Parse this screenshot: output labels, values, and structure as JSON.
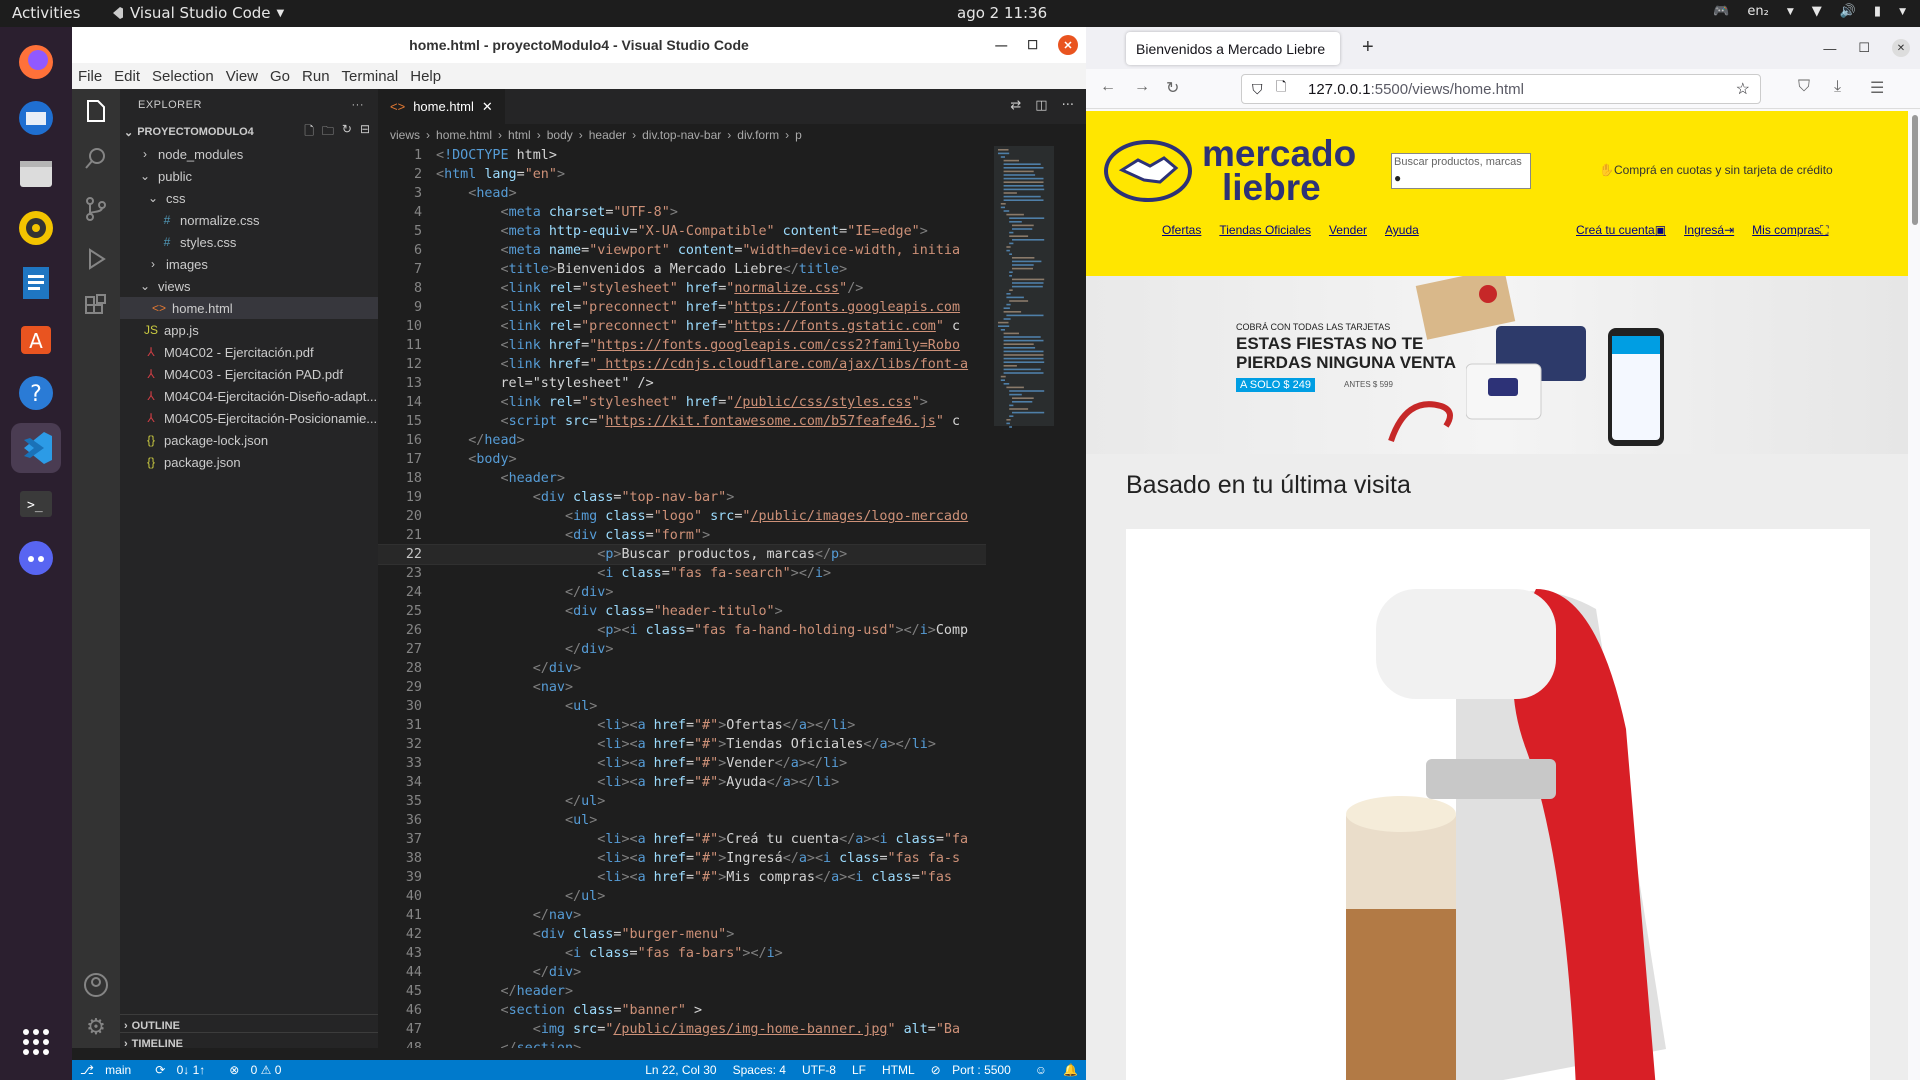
{
  "topbar": {
    "activities": "Activities",
    "app_name": "Visual Studio Code",
    "clock": "ago 2  11:36",
    "lang": "en₂"
  },
  "dock": {
    "items": [
      "firefox-icon",
      "thunderbird-icon",
      "files-icon",
      "rhythmbox-icon",
      "writer-icon",
      "software-icon",
      "help-icon",
      "vscode-icon",
      "terminal-icon",
      "discord-icon",
      "apps-grid-icon"
    ]
  },
  "vscode": {
    "title": "home.html - proyectoModulo4 - Visual Studio Code",
    "menu": [
      "File",
      "Edit",
      "Selection",
      "View",
      "Go",
      "Run",
      "Terminal",
      "Help"
    ],
    "explorer": {
      "header": "EXPLORER",
      "project": "PROYECTOMODULO4",
      "tree": [
        {
          "label": "node_modules",
          "type": "folder",
          "level": 1
        },
        {
          "label": "public",
          "type": "folder-open",
          "level": 1
        },
        {
          "label": "css",
          "type": "folder-open",
          "level": 2
        },
        {
          "label": "normalize.css",
          "type": "css",
          "level": 3
        },
        {
          "label": "styles.css",
          "type": "css",
          "level": 3
        },
        {
          "label": "images",
          "type": "folder",
          "level": 2
        },
        {
          "label": "views",
          "type": "folder-open",
          "level": 1
        },
        {
          "label": "home.html",
          "type": "html",
          "level": 2,
          "selected": true
        },
        {
          "label": "app.js",
          "type": "js",
          "level": 1
        },
        {
          "label": "M04C02 - Ejercitación.pdf",
          "type": "pdf",
          "level": 1
        },
        {
          "label": "M04C03 - Ejercitación PAD.pdf",
          "type": "pdf",
          "level": 1
        },
        {
          "label": "M04C04-Ejercitación-Diseño-adapt...",
          "type": "pdf",
          "level": 1
        },
        {
          "label": "M04C05-Ejercitación-Posicionamie...",
          "type": "pdf",
          "level": 1
        },
        {
          "label": "package-lock.json",
          "type": "json",
          "level": 1
        },
        {
          "label": "package.json",
          "type": "json",
          "level": 1
        }
      ],
      "outline": "OUTLINE",
      "timeline": "TIMELINE"
    },
    "tab": "home.html",
    "breadcrumbs": [
      "views",
      "home.html",
      "html",
      "body",
      "header",
      "div.top-nav-bar",
      "div.form",
      "p"
    ],
    "current_line": 22,
    "code": [
      "<!DOCTYPE html>",
      "<html lang=\"en\">",
      "    <head>",
      "        <meta charset=\"UTF-8\">",
      "        <meta http-equiv=\"X-UA-Compatible\" content=\"IE=edge\">",
      "        <meta name=\"viewport\" content=\"width=device-width, initia",
      "        <title>Bienvenidos a Mercado Liebre</title>",
      "        <link rel=\"stylesheet\" href=\"normalize.css\"/>",
      "        <link rel=\"preconnect\" href=\"https://fonts.googleapis.com",
      "        <link rel=\"preconnect\" href=\"https://fonts.gstatic.com\" c",
      "        <link href=\"https://fonts.googleapis.com/css2?family=Robo",
      "        <link href=\" https://cdnjs.cloudflare.com/ajax/libs/font-a",
      "        rel=\"stylesheet\" />",
      "        <link rel=\"stylesheet\" href=\"/public/css/styles.css\">",
      "        <script src=\"https://kit.fontawesome.com/b57feafe46.js\" c",
      "    </head>",
      "    <body>",
      "        <header>",
      "            <div class=\"top-nav-bar\">",
      "                <img class=\"logo\" src=\"/public/images/logo-mercado",
      "                <div class=\"form\">",
      "                    <p>Buscar productos, marcas</p>",
      "                    <i class=\"fas fa-search\"></i>",
      "                </div>",
      "                <div class=\"header-titulo\">",
      "                    <p><i class=\"fas fa-hand-holding-usd\"></i>Comp",
      "                </div>",
      "            </div>",
      "            <nav>",
      "                <ul>",
      "                    <li><a href=\"#\">Ofertas</a></li>",
      "                    <li><a href=\"#\">Tiendas Oficiales</a></li>",
      "                    <li><a href=\"#\">Vender</a></li>",
      "                    <li><a href=\"#\">Ayuda</a></li>",
      "                </ul>",
      "                <ul>",
      "                    <li><a href=\"#\">Creá tu cuenta</a><i class=\"fa",
      "                    <li><a href=\"#\">Ingresá</a><i class=\"fas fa-s",
      "                    <li><a href=\"#\">Mis compras</a><i class=\"fas ",
      "                </ul>",
      "            </nav>",
      "            <div class=\"burger-menu\">",
      "                <i class=\"fas fa-bars\"></i>",
      "            </div>",
      "        </header>",
      "        <section class=\"banner\" >",
      "            <img src=\"/public/images/img-home-banner.jpg\" alt=\"Ba",
      "        </section>"
    ],
    "status": {
      "branch": "main",
      "sync": "0↓ 1↑",
      "problems": "0 ⚠ 0",
      "position": "Ln 22, Col 30",
      "spaces": "Spaces: 4",
      "encoding": "UTF-8",
      "eol": "LF",
      "language": "HTML",
      "port": "Port : 5500"
    }
  },
  "browser": {
    "tab_title": "Bienvenidos a Mercado Liebre",
    "url_host": "127.0.0.1",
    "url_path": ":5500/views/home.html",
    "page": {
      "logo_line1": "mercado",
      "logo_line2": "liebre",
      "search_placeholder": "Buscar productos, marcas",
      "promo": "Comprá en cuotas y sin tarjeta de crédito",
      "nav_left": [
        "Ofertas",
        "Tiendas Oficiales",
        "Vender",
        "Ayuda"
      ],
      "nav_right": [
        "Creá tu cuenta",
        "Ingresá",
        "Mis compras"
      ],
      "banner": {
        "kicker": "COBRÁ CON TODAS LAS TARJETAS",
        "headline1": "ESTAS FIESTAS NO TE",
        "headline2": "PIERDAS NINGUNA VENTA",
        "price": "A SOLO $ 249",
        "old_price": "ANTES $ 599"
      },
      "section_title": "Basado en tu última visita"
    }
  },
  "colors": {
    "brand_yellow": "#ffe600",
    "brand_blue": "#2d3277",
    "vscode_blue": "#007acc"
  }
}
